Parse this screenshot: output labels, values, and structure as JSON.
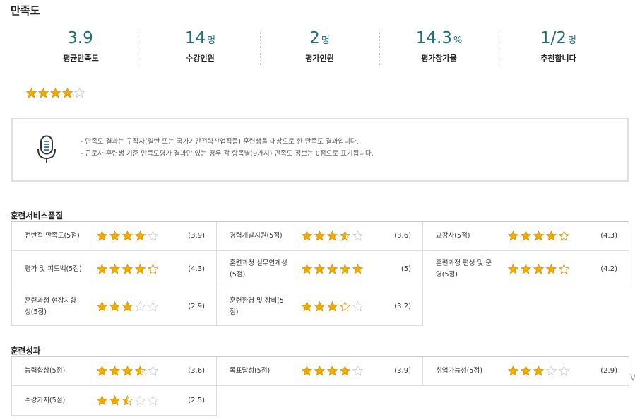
{
  "page_title": "만족도",
  "stats": [
    {
      "value": "3.9",
      "unit": "",
      "label": "평균만족도"
    },
    {
      "value": "14",
      "unit": "명",
      "label": "수강인원"
    },
    {
      "value": "2",
      "unit": "명",
      "label": "평가인원"
    },
    {
      "value": "14.3",
      "unit": "%",
      "label": "평가참가율"
    },
    {
      "value": "1/2",
      "unit": "명",
      "label": "추천합니다"
    }
  ],
  "summary_rating": 3.9,
  "notice": {
    "icon": "microphone-icon",
    "lines": [
      "- 만족도 결과는 구직자(일반 또는 국가기간전략산업직종) 훈련생을 대상으로 한 만족도 결과입니다.",
      "- 근로자 훈련생 기준 만족도평가 결과만 있는 경우 각 항목별(9가지) 만족도 정보는 0점으로 표기됩니다."
    ]
  },
  "service_quality": {
    "title": "훈련서비스품질",
    "items": [
      {
        "label": "전반적 만족도(5점)",
        "rating": 3.9,
        "score": "(3.9)"
      },
      {
        "label": "경력개발지원(5점)",
        "rating": 3.6,
        "score": "(3.6)"
      },
      {
        "label": "교강사(5점)",
        "rating": 4.3,
        "score": "(4.3)"
      },
      {
        "label": "평가 및 피드백(5점)",
        "rating": 4.3,
        "score": "(4.3)"
      },
      {
        "label": "훈련과정 실무연계성(5점)",
        "rating": 5,
        "score": "(5)"
      },
      {
        "label": "훈련과정 편성 및 운영(5점)",
        "rating": 4.2,
        "score": "(4.2)"
      },
      {
        "label": "훈련과정 현장지향성(5점)",
        "rating": 2.9,
        "score": "(2.9)"
      },
      {
        "label": "훈련환경 및 장비(5점)",
        "rating": 3.2,
        "score": "(3.2)"
      }
    ]
  },
  "outcomes": {
    "title": "훈련성과",
    "items": [
      {
        "label": "능력향상(5점)",
        "rating": 3.6,
        "score": "(3.6)"
      },
      {
        "label": "목표달성(5점)",
        "rating": 3.9,
        "score": "(3.9)"
      },
      {
        "label": "취업가능성(5점)",
        "rating": 2.9,
        "score": "(2.9)"
      },
      {
        "label": "수강가치(5점)",
        "rating": 2.5,
        "score": "(2.5)"
      }
    ]
  },
  "colors": {
    "accent": "#1b6f72",
    "star_fill": "#f2a900",
    "star_empty": "#c8c8c8"
  }
}
